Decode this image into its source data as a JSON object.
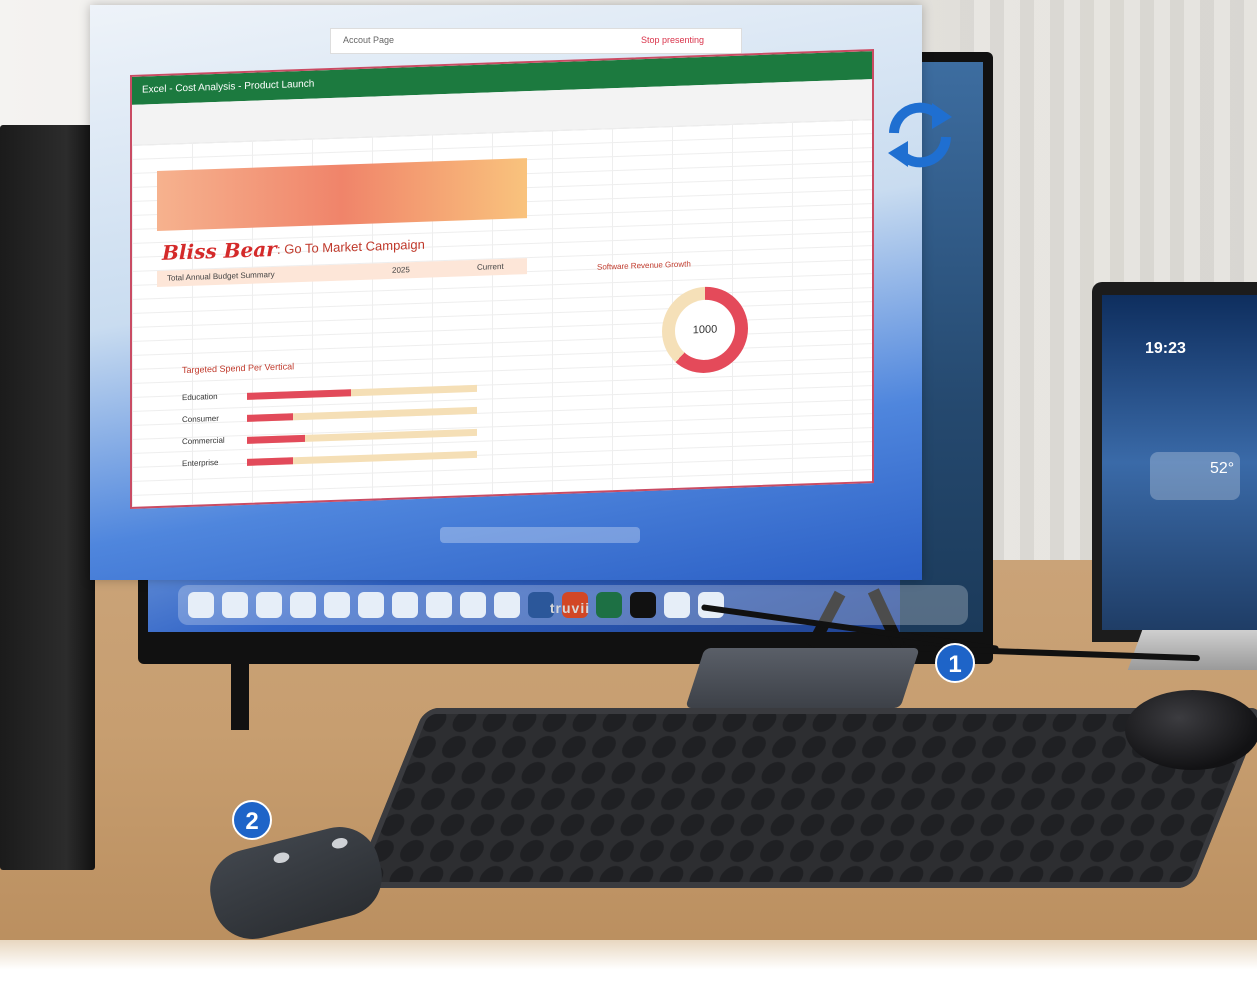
{
  "topbar": {
    "left_text": "Accout Page",
    "right_text": "Stop presenting"
  },
  "excel": {
    "title": "Excel - Cost Analysis - Product Launch",
    "brand": "Bliss Bear",
    "campaign": ": Go To Market Campaign",
    "table_label": "Total Annual Budget Summary",
    "col1": "2025",
    "col2": "Current",
    "bar_chart_title": "Targeted Spend Per Vertical",
    "bar_labels": [
      "Education",
      "Consumer",
      "Commercial",
      "Enterprise"
    ],
    "bar_values": [
      0.45,
      0.2,
      0.25,
      0.2
    ],
    "donut_title": "Software Revenue Growth",
    "donut_value": "1000"
  },
  "monitor": {
    "brand": "truvii"
  },
  "laptop": {
    "time": "19:23",
    "temp": "52°"
  },
  "badges": {
    "one": "1",
    "two": "2"
  },
  "colors": {
    "excel_green": "#1c7a3f",
    "accent_red": "#e24a5a",
    "badge_blue": "#1e64c8"
  },
  "icons": [
    "sync-icon",
    "excel-icon",
    "windows-start-icon"
  ]
}
